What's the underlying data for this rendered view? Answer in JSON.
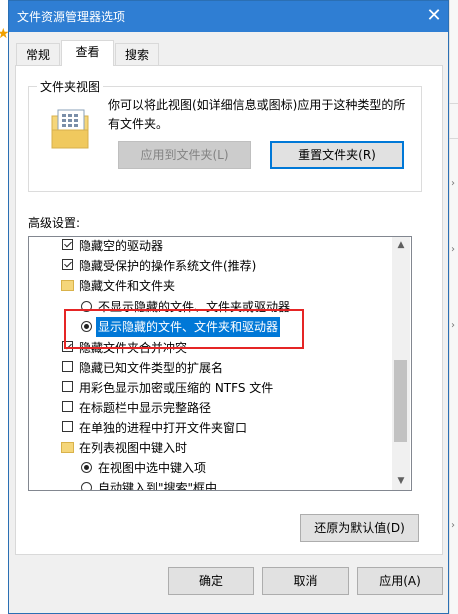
{
  "dialog": {
    "title": "文件资源管理器选项",
    "close_glyph": "✕"
  },
  "tabs": [
    "常规",
    "查看",
    "搜索"
  ],
  "folder_views": {
    "label": "文件夹视图",
    "description": "你可以将此视图(如详细信息或图标)应用于这种类型的所有文件夹。",
    "apply_button": "应用到文件夹(L)",
    "reset_button": "重置文件夹(R)"
  },
  "advanced": {
    "label": "高级设置:",
    "items": [
      {
        "type": "checkbox",
        "checked": true,
        "label": "隐藏空的驱动器"
      },
      {
        "type": "checkbox",
        "checked": true,
        "label": "隐藏受保护的操作系统文件(推荐)"
      },
      {
        "type": "folder",
        "label": "隐藏文件和文件夹"
      },
      {
        "type": "radio",
        "checked": false,
        "label": "不显示隐藏的文件、文件夹或驱动器"
      },
      {
        "type": "radio",
        "checked": true,
        "label": "显示隐藏的文件、文件夹和驱动器"
      },
      {
        "type": "checkbox",
        "checked": true,
        "label": "隐藏文件夹合并冲突"
      },
      {
        "type": "checkbox",
        "checked": false,
        "label": "隐藏已知文件类型的扩展名"
      },
      {
        "type": "checkbox",
        "checked": false,
        "label": "用彩色显示加密或压缩的 NTFS 文件"
      },
      {
        "type": "checkbox",
        "checked": false,
        "label": "在标题栏中显示完整路径"
      },
      {
        "type": "checkbox",
        "checked": false,
        "label": "在单独的进程中打开文件夹窗口"
      },
      {
        "type": "folder",
        "label": "在列表视图中键入时"
      },
      {
        "type": "radio",
        "checked": true,
        "label": "在视图中选中键入项"
      },
      {
        "type": "radio",
        "checked": false,
        "label": "自动键入到\"搜索\"框中"
      }
    ],
    "restore_button": "还原为默认值(D)"
  },
  "footer": {
    "ok": "确定",
    "cancel": "取消",
    "apply": "应用(A)"
  },
  "colors": {
    "title_bar": "#2f7ed3",
    "selection": "#0078d7",
    "annotation": "#e52525"
  }
}
